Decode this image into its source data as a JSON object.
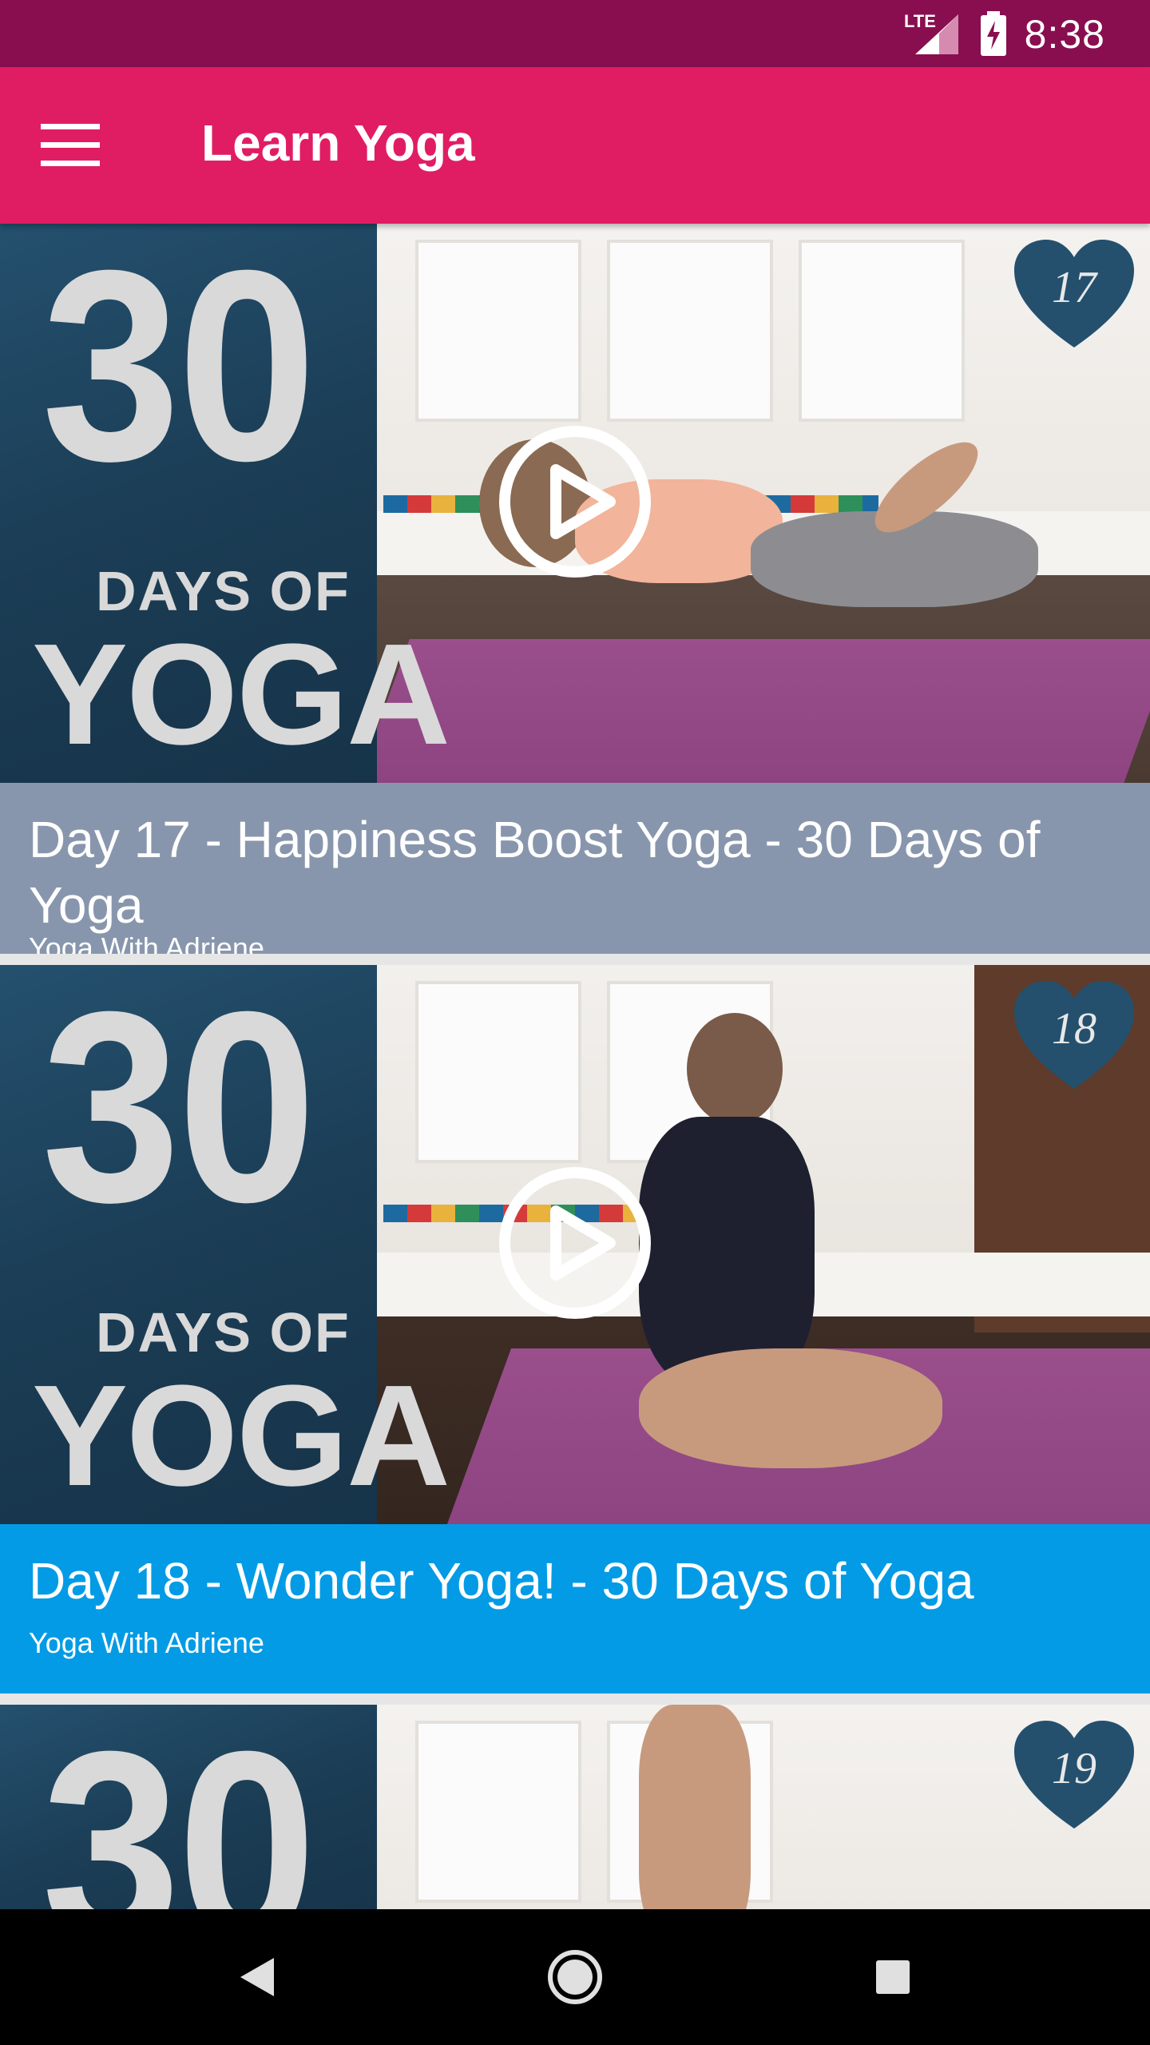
{
  "status_bar": {
    "network": "LTE",
    "time": "8:38"
  },
  "app_bar": {
    "title": "Learn Yoga",
    "menu_icon": "hamburger-menu-icon"
  },
  "videos": [
    {
      "thumbnail": {
        "big_number": "30",
        "days_of": "DAYS OF",
        "yoga": "YOGA",
        "heart_number": "17"
      },
      "title": "Day 17 - Happiness Boost Yoga - 30 Days of Yoga",
      "channel": "Yoga With Adriene",
      "caption_color": "#8896ad"
    },
    {
      "thumbnail": {
        "big_number": "30",
        "days_of": "DAYS OF",
        "yoga": "YOGA",
        "heart_number": "18"
      },
      "title": "Day 18 - Wonder Yoga! - 30 Days of Yoga",
      "channel": "Yoga With Adriene",
      "caption_color": "#039be5"
    },
    {
      "thumbnail": {
        "big_number": "30",
        "heart_number": "19"
      }
    }
  ],
  "nav_bar": {
    "back_icon": "back-triangle-icon",
    "home_icon": "home-circle-icon",
    "recents_icon": "recents-square-icon"
  },
  "colors": {
    "status_bar": "#880e4f",
    "app_bar": "#e01d63",
    "caption_highlight": "#039be5",
    "caption_default": "#8896ad"
  }
}
